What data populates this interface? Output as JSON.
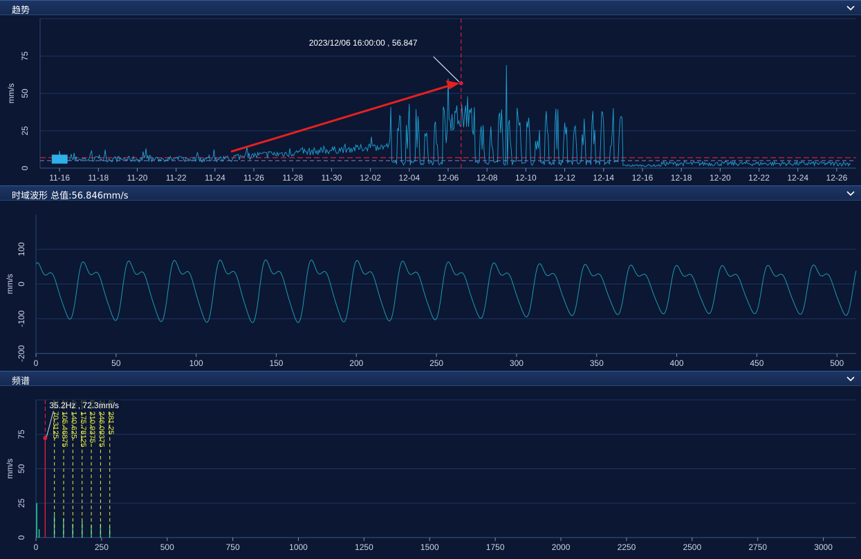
{
  "panels": [
    {
      "title": "趋势"
    },
    {
      "title": "时域波形 总值:56.846mm/s"
    },
    {
      "title": "频谱"
    }
  ],
  "colors": {
    "line": "#1fa3d6",
    "wave": "#1d9bb0",
    "marker": "#d81e3c",
    "harmonic": "#e6e84a",
    "annotation_arrow": "#e62020"
  },
  "chart_data": [
    {
      "type": "line",
      "title": "",
      "ylabel": "mm/s",
      "x_tick_labels": [
        "11-16",
        "11-18",
        "11-20",
        "11-22",
        "11-24",
        "11-26",
        "11-28",
        "11-30",
        "12-02",
        "12-04",
        "12-06",
        "12-08",
        "12-10",
        "12-12",
        "12-14",
        "12-16",
        "12-18",
        "12-20",
        "12-22",
        "12-24",
        "12-26"
      ],
      "y_ticks": [
        0,
        25,
        50,
        75
      ],
      "ylim": [
        0,
        100
      ],
      "xlim": [
        "2023-11-15",
        "2023-12-27"
      ],
      "alarm_lines": [
        7,
        5
      ],
      "cursor": {
        "x": "2023-12-06 16:00:00",
        "label": "2023/12/06 16:00:00 , 56.847",
        "value": 56.847
      },
      "peaks": [
        {
          "x": "2023-12-04",
          "y": 43
        },
        {
          "x": "2023-12-06",
          "y": 60
        },
        {
          "x": "2023-12-07",
          "y": 48
        },
        {
          "x": "2023-12-09",
          "y": 69
        },
        {
          "x": "2023-12-11",
          "y": 30
        },
        {
          "x": "2023-12-13",
          "y": 33
        }
      ],
      "grid": true
    },
    {
      "type": "line",
      "title": "",
      "ylabel": "mm/s",
      "x_ticks": [
        0,
        50,
        100,
        150,
        200,
        250,
        300,
        350,
        400,
        450,
        500
      ],
      "y_ticks": [
        -200,
        -100,
        0,
        100
      ],
      "ylim": [
        -200,
        200
      ],
      "xlim": [
        0,
        512
      ],
      "period": 28.5,
      "amplitude": [
        -120,
        100
      ],
      "grid": true
    },
    {
      "type": "bar",
      "title": "",
      "ylabel": "mm/s",
      "x_ticks": [
        0,
        250,
        500,
        750,
        1000,
        1250,
        1500,
        1750,
        2000,
        2250,
        2500,
        2750,
        3000
      ],
      "y_ticks": [
        0,
        25,
        50,
        75
      ],
      "ylim": [
        0,
        100
      ],
      "xlim": [
        0,
        3125
      ],
      "cursor": {
        "x": 35.2,
        "label": "35.2Hz , 72.3mm/s",
        "value": 72.3
      },
      "harmonics": [
        {
          "label": "2X",
          "value": "70.3125",
          "x": 70.3
        },
        {
          "label": "3X",
          "value": "105.46875",
          "x": 105.5
        },
        {
          "label": "4X",
          "value": "140.625",
          "x": 140.6
        },
        {
          "label": "5X",
          "value": "175.78125",
          "x": 175.8
        },
        {
          "label": "6X",
          "value": "210.9375",
          "x": 210.9
        },
        {
          "label": "7X",
          "value": "246.09375",
          "x": 246.1
        },
        {
          "label": "8X",
          "value": "281.25",
          "x": 281.25
        }
      ],
      "grid": true
    }
  ]
}
